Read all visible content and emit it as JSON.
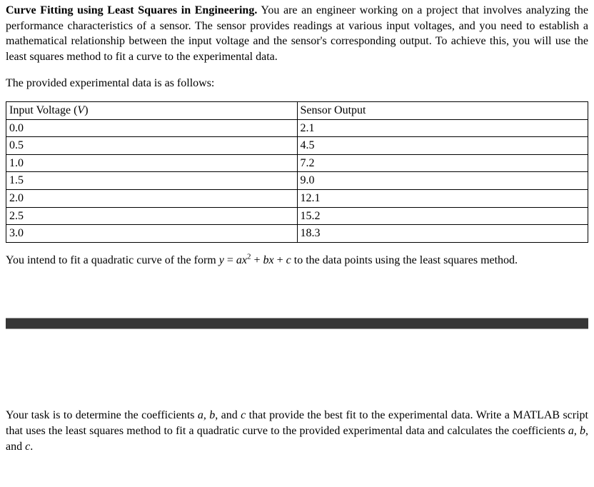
{
  "intro": {
    "title": "Curve Fitting using Least Squares in Engineering.",
    "body": " You are an engineer working on a project that involves analyzing the performance characteristics of a sensor. The sensor provides readings at various input voltages, and you need to establish a mathematical relationship between the input voltage and the sensor's corresponding output. To achieve this, you will use the least squares method to fit a curve to the experimental data."
  },
  "data_label": "The provided experimental data is as follows:",
  "table": {
    "header": {
      "col1_prefix": "Input Voltage (",
      "col1_var": "V",
      "col1_suffix": ")",
      "col2": "Sensor Output"
    },
    "rows": [
      {
        "v": "0.0",
        "out": "2.1"
      },
      {
        "v": "0.5",
        "out": "4.5"
      },
      {
        "v": "1.0",
        "out": "7.2"
      },
      {
        "v": "1.5",
        "out": "9.0"
      },
      {
        "v": "2.0",
        "out": "12.1"
      },
      {
        "v": "2.5",
        "out": "15.2"
      },
      {
        "v": "3.0",
        "out": "18.3"
      }
    ]
  },
  "fit_text": {
    "p1": "You intend to fit a quadratic curve of the form ",
    "eq_y": "y",
    "eq_eq": " = ",
    "eq_a": "a",
    "eq_x": "x",
    "eq_sq": "2",
    "eq_plus1": " + ",
    "eq_b": "b",
    "eq_plus2": " + ",
    "eq_c": "c",
    "p2": " to the data points using the least squares method."
  },
  "task": {
    "p1": "Your task is to determine the coefficients ",
    "a": "a",
    "comma1": ", ",
    "b": "b",
    "comma2": ", and ",
    "c": "c",
    "p2": " that provide the best fit to the experimental data. Write a MATLAB script that uses the least squares method to fit a quadratic curve to the provided experimental data and calculates the coefficients ",
    "p3": "."
  }
}
